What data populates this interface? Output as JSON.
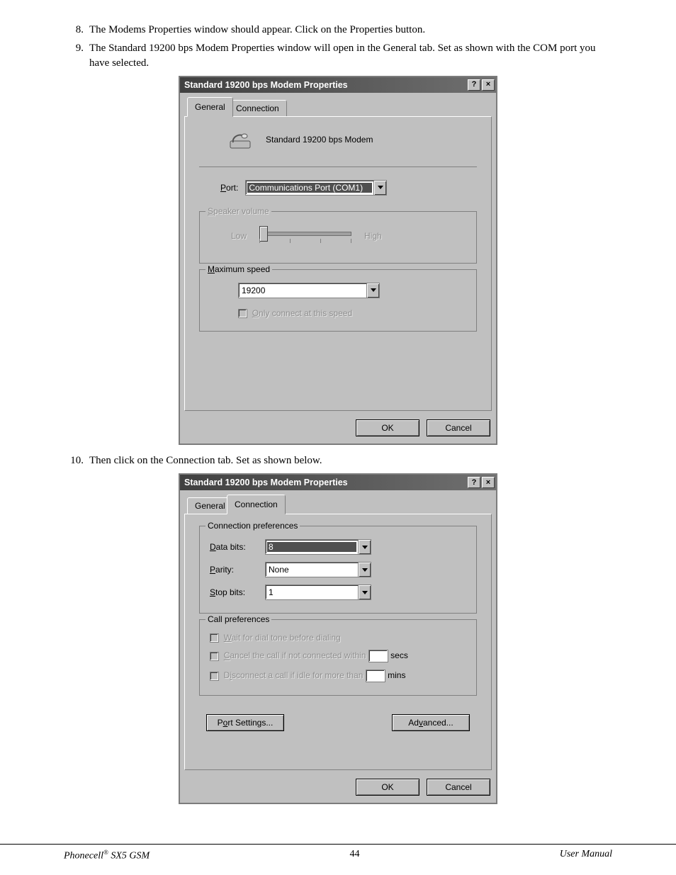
{
  "steps": {
    "s8": {
      "num": "8.",
      "text": "The Modems Properties window should appear. Click on the Properties button."
    },
    "s9": {
      "num": "9.",
      "text": "The Standard 19200 bps Modem Properties window will open in the General tab. Set as shown with the COM port you have selected."
    },
    "s10": {
      "num": "10.",
      "text": "Then click on the Connection tab. Set as shown below."
    }
  },
  "dialog": {
    "title": "Standard 19200 bps Modem Properties",
    "help_glyph": "?",
    "close_glyph": "×",
    "tabs": {
      "general": "General",
      "connection": "Connection"
    },
    "modem_name": "Standard 19200 bps Modem",
    "port_label": "Port:",
    "port_value": "Communications Port (COM1)",
    "speaker": {
      "legend": "Speaker volume",
      "low": "Low",
      "high": "High"
    },
    "maxspeed": {
      "legend": "Maximum speed",
      "value": "19200",
      "only_connect": "Only connect at this speed"
    },
    "connprefs": {
      "legend": "Connection preferences",
      "databits_l": "Data bits:",
      "databits_v": "8",
      "parity_l": "Parity:",
      "parity_v": "None",
      "stopbits_l": "Stop bits:",
      "stopbits_v": "1"
    },
    "callprefs": {
      "legend": "Call preferences",
      "wait": "Wait for dial tone before dialing",
      "cancel": "Cancel the call if not connected within",
      "secs": "secs",
      "disconnect": "Disconnect a call if idle for more than",
      "mins": "mins"
    },
    "buttons": {
      "port_settings": "Port Settings...",
      "advanced": "Advanced...",
      "ok": "OK",
      "cancel": "Cancel"
    }
  },
  "footer": {
    "left1": "Phonecell",
    "left2": " SX5 GSM",
    "pagenum": "44",
    "right": "User Manual"
  }
}
